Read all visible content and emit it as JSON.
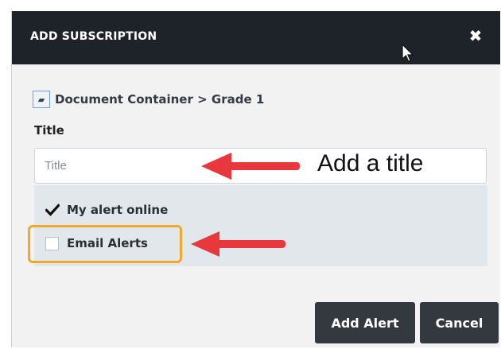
{
  "dialog": {
    "title": "ADD SUBSCRIPTION",
    "close_icon": "close-icon",
    "breadcrumb": {
      "folder_icon": "folder-open-icon",
      "path": "Document Container > Grade 1"
    },
    "title_field": {
      "label": "Title",
      "value": "",
      "placeholder": "Title"
    },
    "options": [
      {
        "label": "My alert online",
        "checked": true
      },
      {
        "label": "Email Alerts",
        "checked": false
      }
    ],
    "buttons": {
      "add": "Add Alert",
      "cancel": "Cancel"
    }
  },
  "annotations": {
    "title_note": "Add a title",
    "arrow_color": "#e8383d",
    "highlight_color": "#f0a830"
  },
  "colors": {
    "header_bg": "#1e2329",
    "button_bg": "#33393f",
    "options_bg": "#e1e7ea"
  }
}
